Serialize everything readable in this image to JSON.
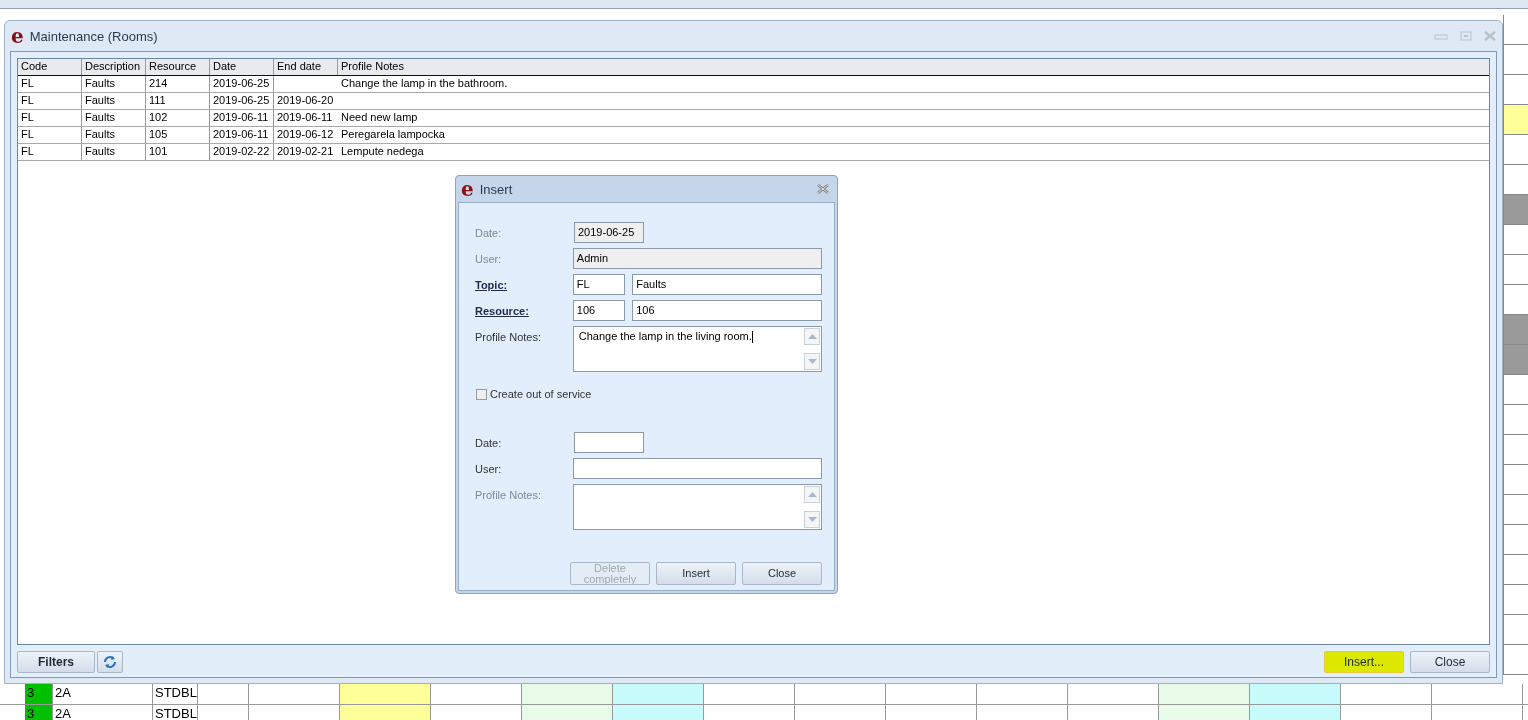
{
  "background": {
    "side_cells": [
      {
        "color": "#ffffff"
      },
      {
        "color": "#ffffff"
      },
      {
        "color": "#ffffff"
      },
      {
        "color": "#ffff99"
      },
      {
        "color": "#ffffff"
      },
      {
        "color": "#ffffff"
      },
      {
        "color": "#9a9a9a"
      },
      {
        "color": "#ffffff"
      },
      {
        "color": "#ffffff"
      },
      {
        "color": "#ffffff"
      },
      {
        "color": "#9a9a9a"
      },
      {
        "color": "#9a9a9a"
      },
      {
        "color": "#ffffff"
      },
      {
        "color": "#ffffff"
      },
      {
        "color": "#ffffff"
      },
      {
        "color": "#ffffff"
      },
      {
        "color": "#ffffff"
      },
      {
        "color": "#ffffff"
      },
      {
        "color": "#ffffff"
      },
      {
        "color": "#ffffff"
      },
      {
        "color": "#ffffff"
      },
      {
        "color": "#ffffff"
      }
    ],
    "rows": [
      {
        "cells": [
          {
            "text": "3",
            "color": "#00c000"
          },
          {
            "text": "2A",
            "color": "#ffffff"
          },
          {
            "text": "STDBL",
            "color": "#ffffff"
          },
          {
            "color": "#ffffff"
          },
          {
            "color": "#ffffff"
          },
          {
            "color": "#ffff99"
          },
          {
            "color": "#ffffff"
          },
          {
            "color": "#e8fbe8"
          },
          {
            "color": "#c8fcfc"
          },
          {
            "color": "#ffffff"
          },
          {
            "color": "#ffffff"
          },
          {
            "color": "#ffffff"
          },
          {
            "color": "#ffffff"
          },
          {
            "color": "#ffffff"
          },
          {
            "color": "#e8fbe8"
          },
          {
            "color": "#c8fcfc"
          },
          {
            "color": "#ffffff"
          },
          {
            "color": "#ffffff"
          }
        ]
      },
      {
        "cells": [
          {
            "text": "3",
            "color": "#00c000"
          },
          {
            "text": "2A",
            "color": "#ffffff"
          },
          {
            "text": "STDBL",
            "color": "#ffffff"
          },
          {
            "color": "#ffffff"
          },
          {
            "color": "#ffffff"
          },
          {
            "color": "#ffff99"
          },
          {
            "color": "#ffffff"
          },
          {
            "color": "#e8fbe8"
          },
          {
            "color": "#c8fcfc"
          },
          {
            "color": "#ffffff"
          },
          {
            "color": "#ffffff"
          },
          {
            "color": "#ffffff"
          },
          {
            "color": "#ffffff"
          },
          {
            "color": "#ffffff"
          },
          {
            "color": "#e8fbe8"
          },
          {
            "color": "#c8fcfc"
          },
          {
            "color": "#ffffff"
          },
          {
            "color": "#ffffff"
          }
        ]
      }
    ]
  },
  "window": {
    "logo": "e",
    "title": "Maintenance (Rooms)",
    "table": {
      "columns": [
        "Code",
        "Description",
        "Resource",
        "Date",
        "End date",
        "Profile Notes"
      ],
      "rows": [
        [
          "FL",
          "Faults",
          "214",
          "2019-06-25",
          "",
          "Change the lamp in the bathroom."
        ],
        [
          "FL",
          "Faults",
          "111",
          "2019-06-25",
          "2019-06-20",
          ""
        ],
        [
          "FL",
          "Faults",
          "102",
          "2019-06-11",
          "2019-06-11",
          "Need new lamp"
        ],
        [
          "FL",
          "Faults",
          "105",
          "2019-06-11",
          "2019-06-12",
          "Peregarela lampocka"
        ],
        [
          "FL",
          "Faults",
          "101",
          "2019-02-22",
          "2019-02-21",
          "Lempute nedega"
        ]
      ]
    },
    "footer_left": [
      {
        "kind": "text",
        "label": "Filters"
      },
      {
        "kind": "refresh"
      }
    ],
    "footer_right": [
      {
        "label": "Insert...",
        "focused": true
      },
      {
        "label": "Close",
        "focused": false
      }
    ]
  },
  "insert_dialog": {
    "logo": "e",
    "title": "Insert",
    "fields": [
      {
        "label": "Date:",
        "kind": "short",
        "value": "2019-06-25",
        "disabled": true,
        "dimmed": true,
        "link": false
      },
      {
        "label": "User:",
        "kind": "wide",
        "value": "Admin",
        "disabled": true,
        "dimmed": true,
        "link": false
      },
      {
        "label": "Topic:",
        "kind": "pair",
        "code": "FL",
        "value": "Faults",
        "disabled": false,
        "dimmed": false,
        "link": true
      },
      {
        "label": "Resource:",
        "kind": "pair",
        "code": "106",
        "value": "106",
        "disabled": false,
        "dimmed": false,
        "link": true
      },
      {
        "label": "Profile Notes:",
        "kind": "notes",
        "value": "Change the lamp in the living room.",
        "disabled": false,
        "dimmed": false,
        "link": false
      }
    ],
    "checkbox": {
      "label": "Create out of service",
      "checked": false
    },
    "service_fields": [
      {
        "label": "Date:",
        "kind": "short",
        "disabled": false,
        "dimmed": false,
        "link": false
      },
      {
        "label": "User:",
        "kind": "wide",
        "disabled": false,
        "dimmed": false,
        "link": false
      },
      {
        "label": "Profile Notes:",
        "kind": "notes",
        "disabled": false,
        "dimmed": true,
        "link": false
      }
    ],
    "buttons": [
      {
        "label": "Delete completely",
        "disabled": true
      },
      {
        "label": "Insert",
        "disabled": false
      },
      {
        "label": "Close",
        "disabled": false
      }
    ]
  }
}
